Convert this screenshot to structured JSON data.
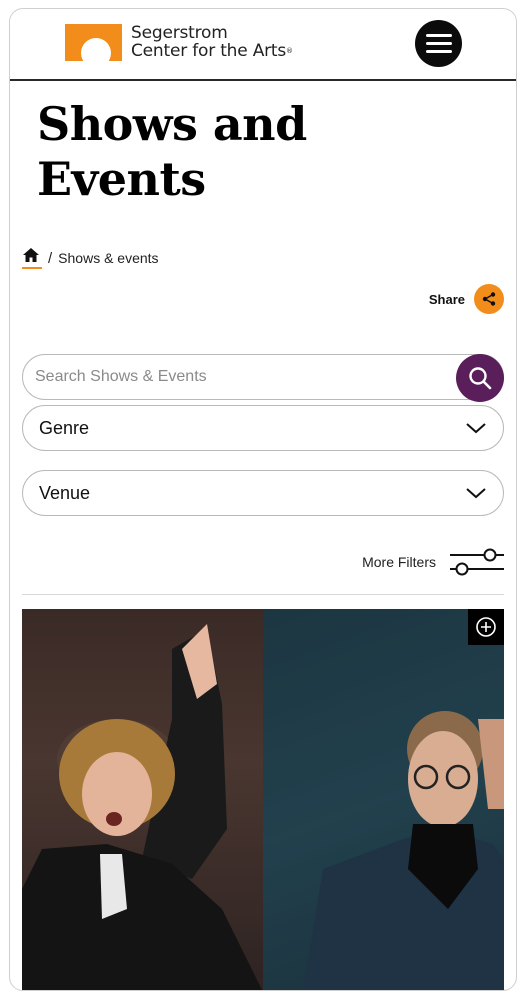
{
  "header": {
    "logo_line1": "Segerstrom",
    "logo_line2": "Center for the Arts",
    "logo_reg": "®",
    "menu_icon": "hamburger-icon"
  },
  "page": {
    "title": "Shows and Events"
  },
  "breadcrumb": {
    "home_icon": "home-icon",
    "separator": "/",
    "current": "Shows & events"
  },
  "share": {
    "label": "Share",
    "icon": "share-icon"
  },
  "search": {
    "placeholder": "Search Shows & Events",
    "value": "",
    "icon": "search-icon"
  },
  "filters": {
    "genre_label": "Genre",
    "venue_label": "Venue",
    "more_label": "More Filters",
    "more_icon": "sliders-icon"
  },
  "card": {
    "add_icon": "plus-circle-icon"
  },
  "colors": {
    "accent": "#f28c1a",
    "search_button": "#5a1f5a",
    "text": "#111111"
  }
}
